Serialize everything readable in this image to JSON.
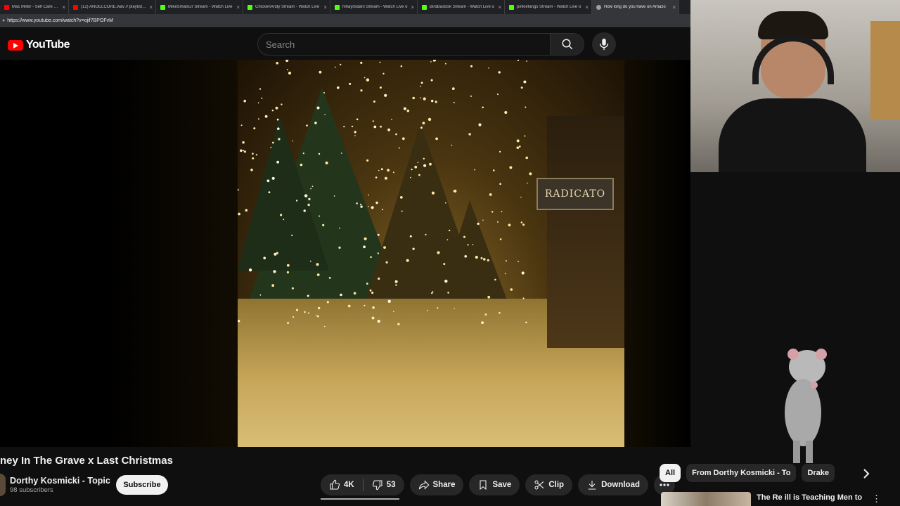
{
  "browser": {
    "tabs": [
      {
        "title": "Mac Miller - Self Care - YouTu",
        "icon": "youtube-favicon"
      },
      {
        "title": "(12) ANGELCORE.wav // playlist ju",
        "icon": "youtube-favicon"
      },
      {
        "title": "MikeSmallsJr Stream - Watch Live",
        "icon": "kick-favicon"
      },
      {
        "title": "ChickenAndy Stream - Watch Live",
        "icon": "kick-favicon"
      },
      {
        "title": "hihayitsdani Stream - Watch Live o",
        "icon": "kick-favicon"
      },
      {
        "title": "BirdBasBsk Stream - Watch Live o",
        "icon": "kick-favicon"
      },
      {
        "title": "pinkiefangs Stream - Watch Live o",
        "icon": "kick-favicon"
      },
      {
        "title": "How long do you have on Amazo",
        "icon": "google-favicon"
      }
    ],
    "url": "https://www.youtube.com/watch?v=ojif7BPOFvM"
  },
  "masthead": {
    "logo_text": "YouTube",
    "search_placeholder": "Search"
  },
  "video": {
    "sign_text": "RADICATO",
    "title": "ney In The Grave x Last Christmas",
    "channel": "Dorthy Kosmicki - Topic",
    "subscribers": "98 subscribers",
    "subscribe_label": "Subscribe",
    "likes": "4K",
    "dislikes": "53",
    "share_label": "Share",
    "save_label": "Save",
    "clip_label": "Clip",
    "download_label": "Download"
  },
  "sidebar": {
    "chips": [
      "All",
      "From Dorthy Kosmicki - To",
      "Drake"
    ],
    "recommendation_title": "The Re  ill is Teaching Men to"
  },
  "colors": {
    "background": "#0f0f0f",
    "brand_red": "#ff0000",
    "pill": "#272727",
    "text": "#f1f1f1",
    "kick_green": "#53fc18"
  }
}
